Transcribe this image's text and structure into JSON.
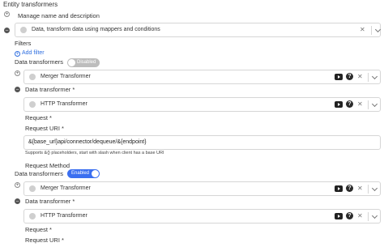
{
  "section_title": "Entity transformers",
  "manage": {
    "label": "Manage name and description",
    "selector_value": "Data, transform data using mappers and conditions"
  },
  "filters": {
    "label": "Filters",
    "add_filter": "Add filter"
  },
  "groups": [
    {
      "label": "Data transformers",
      "toggle": "Disabled",
      "selector_value": "Merger Transformer",
      "transformer_label": "Data transformer *",
      "transformer_value": "HTTP Transformer",
      "request_label": "Request *",
      "request_uri_label": "Request URI *",
      "request_uri_value": "&{base_url}api/connector/dequeue/&{endpoint}",
      "request_uri_help": "Supports &{} placeholders, start with slash when client has a base URI",
      "request_method_label": "Request Method"
    },
    {
      "label": "Data transformers",
      "toggle": "Enabled",
      "selector_value": "Merger Transformer",
      "transformer_label": "Data transformer *",
      "transformer_value": "HTTP Transformer",
      "request_label": "Request *",
      "request_uri_label": "Request URI *"
    }
  ],
  "icons": {
    "video": "video-icon",
    "help": "help-icon",
    "clear": "clear-icon",
    "chevron": "chevron-down-icon",
    "add": "add-circle-icon",
    "collapse": "collapse-icon",
    "remove": "remove-icon"
  },
  "colors": {
    "accent": "#3b6ff0",
    "toggle_off": "#bdbdbd"
  }
}
